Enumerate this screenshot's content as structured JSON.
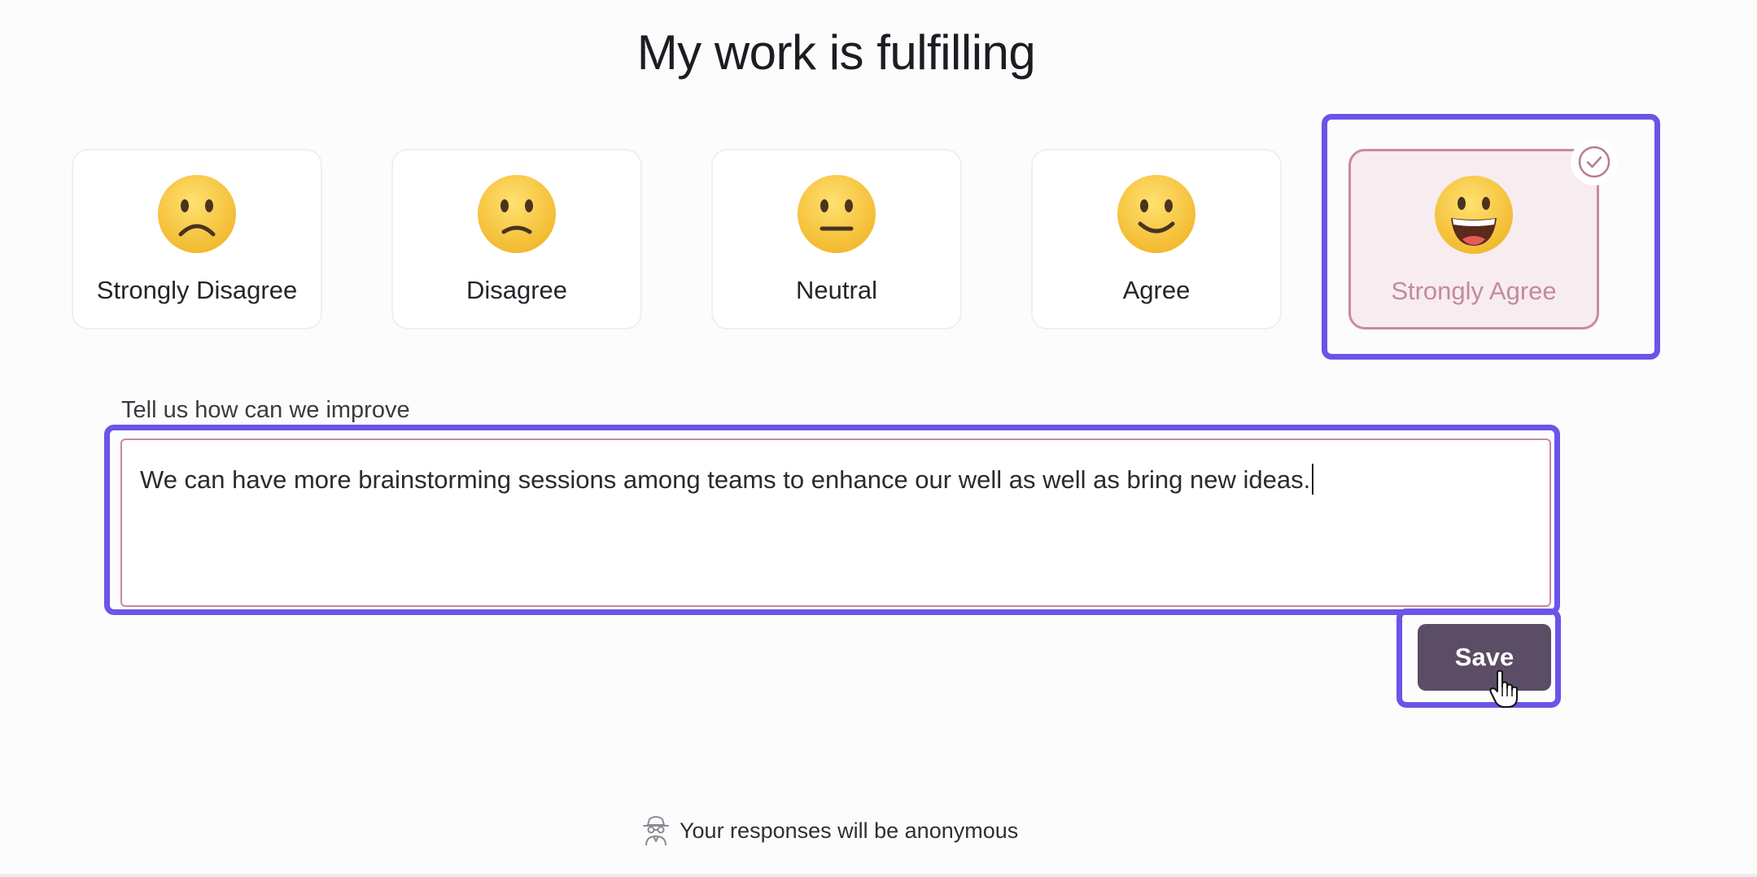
{
  "question": {
    "title": "My work is fulfilling"
  },
  "options": [
    {
      "label": "Strongly Disagree",
      "icon": "frowning-face-icon",
      "selected": false
    },
    {
      "label": "Disagree",
      "icon": "slightly-frowning-face-icon",
      "selected": false
    },
    {
      "label": "Neutral",
      "icon": "neutral-face-icon",
      "selected": false
    },
    {
      "label": "Agree",
      "icon": "slightly-smiling-face-icon",
      "selected": false
    },
    {
      "label": "Strongly Agree",
      "icon": "grinning-face-icon",
      "selected": true
    }
  ],
  "feedback": {
    "label": "Tell us how can we improve",
    "value": "We can have more brainstorming sessions among teams to enhance our well as well as bring new ideas."
  },
  "save": {
    "label": "Save"
  },
  "footer": {
    "anonymous_text": "Your responses will be anonymous",
    "icon": "anonymous-spy-icon"
  },
  "colors": {
    "accent": "#6a55e6",
    "selected_border": "#c98b9e",
    "selected_bg": "#f7ecf0",
    "save_bg": "#5a4d65",
    "emoji_face": "#f6c945"
  }
}
